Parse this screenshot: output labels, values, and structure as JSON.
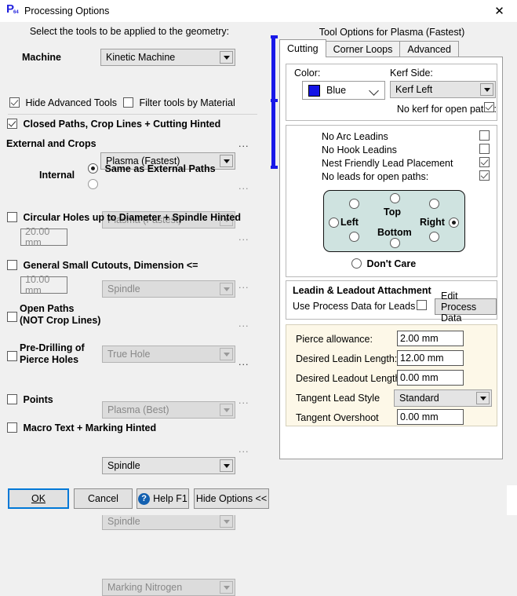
{
  "window": {
    "title": "Processing Options",
    "icon": "app-p64-icon",
    "close_label": "✕"
  },
  "left": {
    "header": "Select the tools to be applied to the geometry:",
    "machine_label": "Machine",
    "machine_value": "Kinetic Machine",
    "hide_advanced_label": "Hide Advanced Tools",
    "hide_advanced_checked": true,
    "filter_material_label": "Filter tools by Material",
    "filter_material_checked": false,
    "closed_paths_label": "Closed Paths,  Crop Lines  +  Cutting Hinted",
    "closed_paths_checked": true,
    "external_label": "External and Crops",
    "external_value": "Plasma (Fastest)",
    "internal_label": "Internal",
    "internal_same_label": "Same as External Paths",
    "internal_same_selected": true,
    "internal_other_value": "Plasma (Fastest)",
    "circular_label": "Circular Holes up to Diameter  +  Spindle Hinted",
    "circular_checked": false,
    "circular_dim": "20.00 mm",
    "circular_tool": "Spindle",
    "general_label": "General Small Cutouts, Dimension <=",
    "general_checked": false,
    "general_dim": "10.00 mm",
    "general_tool": "True Hole",
    "open_paths_label_1": "Open Paths",
    "open_paths_label_2": "(NOT Crop Lines)",
    "open_paths_checked": false,
    "open_paths_tool": "Plasma (Best)",
    "predrill_label_1": "Pre-Drilling of",
    "predrill_label_2": "Pierce Holes",
    "predrill_checked": false,
    "predrill_tool": "Spindle",
    "points_label": "Points",
    "points_checked": false,
    "points_tool": "Spindle",
    "macro_label": "Macro Text  +  Marking Hinted",
    "macro_checked": false,
    "macro_tool": "Marking Nitrogen",
    "ellipsis": "..."
  },
  "right": {
    "title": "Tool Options for Plasma (Fastest)",
    "tabs": [
      {
        "label": "Cutting",
        "active": true
      },
      {
        "label": "Corner Loops",
        "active": false
      },
      {
        "label": "Advanced",
        "active": false
      }
    ],
    "color_label": "Color:",
    "color_value": "Blue",
    "color_hex": "#1414e6",
    "kerf_label": "Kerf Side:",
    "kerf_value": "Kerf Left",
    "no_kerf_label": "No kerf for open paths:",
    "no_kerf_checked": true,
    "options": [
      {
        "label": "No Arc Leadins",
        "checked": false
      },
      {
        "label": "No Hook Leadins",
        "checked": false
      },
      {
        "label": "Nest Friendly Lead Placement",
        "checked": true
      },
      {
        "label": "No leads for open paths:",
        "checked": true
      }
    ],
    "placement": {
      "top_label": "Top",
      "bottom_label": "Bottom",
      "left_label": "Left",
      "right_label": "Right",
      "selected": "right",
      "dont_care_label": "Don't Care",
      "dont_care_selected": false
    },
    "leadin_group_title": "Leadin & Leadout Attachment",
    "use_process_label": "Use Process Data for Leads",
    "use_process_checked": false,
    "edit_process_button": "Edit Process Data",
    "fields": [
      {
        "label": "Pierce allowance:",
        "value": "2.00 mm"
      },
      {
        "label": "Desired Leadin Length:",
        "value": "12.00 mm"
      },
      {
        "label": "Desired Leadout Length:",
        "value": "0.00 mm"
      }
    ],
    "tangent_style_label": "Tangent Lead Style",
    "tangent_style_value": "Standard",
    "tangent_overshoot_label": "Tangent Overshoot",
    "tangent_overshoot_value": "0.00 mm"
  },
  "buttons": {
    "ok": "OK",
    "cancel": "Cancel",
    "help": "Help F1",
    "hide_options": "Hide Options << "
  }
}
